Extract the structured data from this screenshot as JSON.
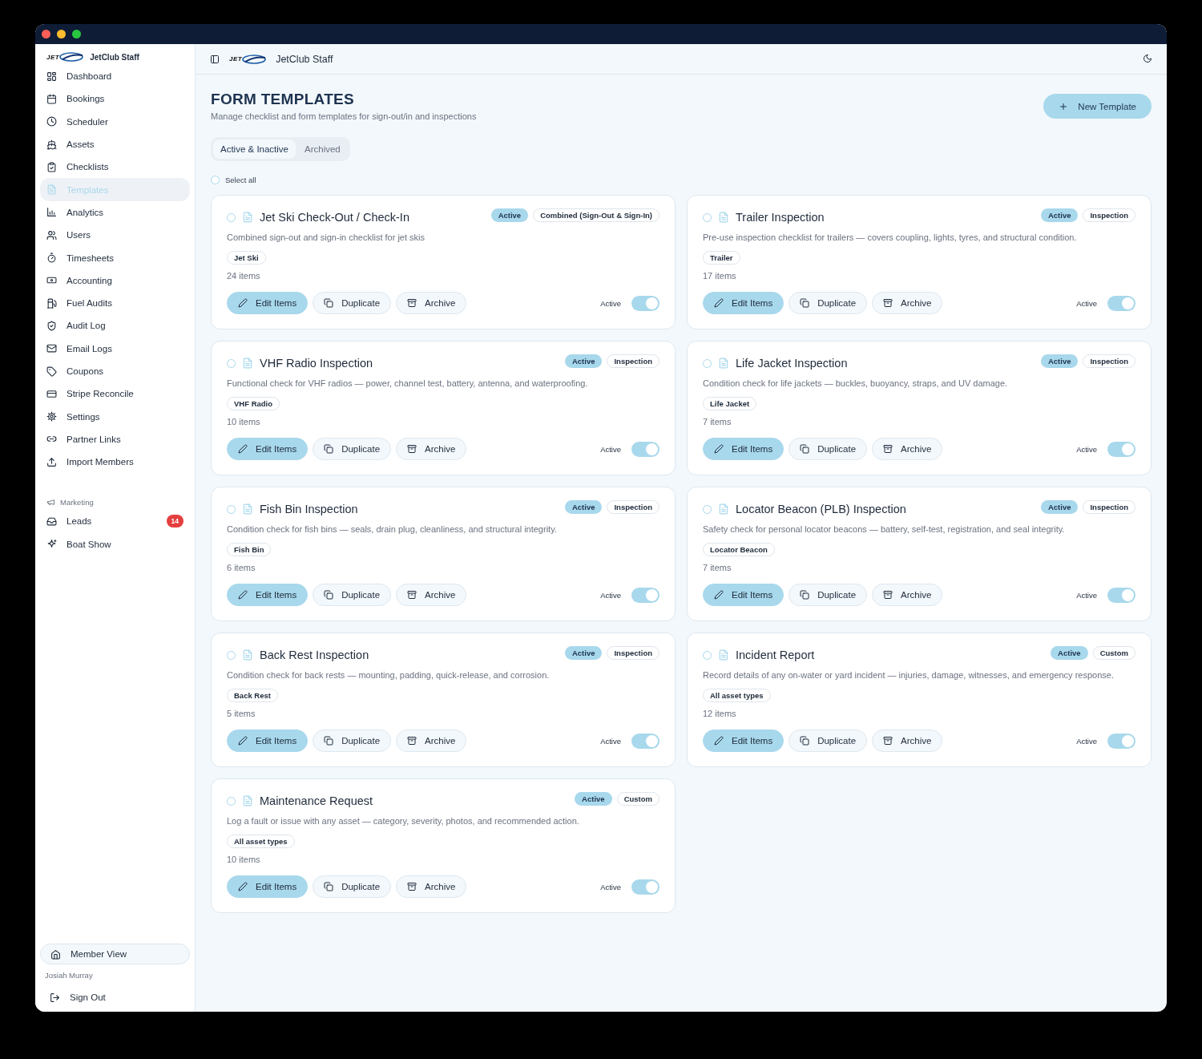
{
  "sidebar": {
    "brand": {
      "logo_text": "JET",
      "name": "JetClub Staff"
    },
    "items": [
      {
        "label": "Dashboard",
        "selected": false
      },
      {
        "label": "Bookings",
        "selected": false
      },
      {
        "label": "Scheduler",
        "selected": false
      },
      {
        "label": "Assets",
        "selected": false
      },
      {
        "label": "Checklists",
        "selected": false
      },
      {
        "label": "Templates",
        "selected": true
      },
      {
        "label": "Analytics",
        "selected": false
      },
      {
        "label": "Users",
        "selected": false
      },
      {
        "label": "Timesheets",
        "selected": false
      },
      {
        "label": "Accounting",
        "selected": false
      },
      {
        "label": "Fuel Audits",
        "selected": false
      },
      {
        "label": "Audit Log",
        "selected": false
      },
      {
        "label": "Email Logs",
        "selected": false
      },
      {
        "label": "Coupons",
        "selected": false
      },
      {
        "label": "Stripe Reconcile",
        "selected": false
      },
      {
        "label": "Settings",
        "selected": false
      },
      {
        "label": "Partner Links",
        "selected": false
      },
      {
        "label": "Import Members",
        "selected": false
      }
    ],
    "section": {
      "title": "Marketing",
      "items": [
        {
          "label": "Leads",
          "badge": "14",
          "selected": false
        },
        {
          "label": "Boat Show",
          "selected": false
        }
      ]
    },
    "member_view": "Member View",
    "user": "Josiah Murray",
    "sign_out": "Sign Out"
  },
  "topbar": {
    "logo_text": "JET",
    "title": "JetClub Staff"
  },
  "page": {
    "title": "FORM TEMPLATES",
    "subtitle": "Manage checklist and form templates for sign-out/in and inspections",
    "new_button": "New Template"
  },
  "tabs": [
    {
      "label": "Active & Inactive",
      "selected": true
    },
    {
      "label": "Archived",
      "selected": false
    }
  ],
  "select_all": {
    "label": "Select all",
    "checked": false
  },
  "templates": [
    {
      "title": "Jet Ski Check-Out / Check-In",
      "status": "Active",
      "type": "Combined (Sign-Out & Sign-In)",
      "description": "Combined sign-out and sign-in checklist for jet skis",
      "asset": "Jet Ski",
      "count": "24 items",
      "checked": false,
      "actions": [
        "Edit Items",
        "Duplicate",
        "Archive"
      ],
      "toggle_label": "Active",
      "active": true
    },
    {
      "title": "Trailer Inspection",
      "status": "Active",
      "type": "Inspection",
      "description": "Pre-use inspection checklist for trailers — covers coupling, lights, tyres, and structural condition.",
      "asset": "Trailer",
      "count": "17 items",
      "checked": false,
      "actions": [
        "Edit Items",
        "Duplicate",
        "Archive"
      ],
      "toggle_label": "Active",
      "active": true
    },
    {
      "title": "VHF Radio Inspection",
      "status": "Active",
      "type": "Inspection",
      "description": "Functional check for VHF radios — power, channel test, battery, antenna, and waterproofing.",
      "asset": "VHF Radio",
      "count": "10 items",
      "checked": false,
      "actions": [
        "Edit Items",
        "Duplicate",
        "Archive"
      ],
      "toggle_label": "Active",
      "active": true
    },
    {
      "title": "Life Jacket Inspection",
      "status": "Active",
      "type": "Inspection",
      "description": "Condition check for life jackets — buckles, buoyancy, straps, and UV damage.",
      "asset": "Life Jacket",
      "count": "7 items",
      "checked": false,
      "actions": [
        "Edit Items",
        "Duplicate",
        "Archive"
      ],
      "toggle_label": "Active",
      "active": true
    },
    {
      "title": "Fish Bin Inspection",
      "status": "Active",
      "type": "Inspection",
      "description": "Condition check for fish bins — seals, drain plug, cleanliness, and structural integrity.",
      "asset": "Fish Bin",
      "count": "6 items",
      "checked": false,
      "actions": [
        "Edit Items",
        "Duplicate",
        "Archive"
      ],
      "toggle_label": "Active",
      "active": true
    },
    {
      "title": "Locator Beacon (PLB) Inspection",
      "status": "Active",
      "type": "Inspection",
      "description": "Safety check for personal locator beacons — battery, self-test, registration, and seal integrity.",
      "asset": "Locator Beacon",
      "count": "7 items",
      "checked": false,
      "actions": [
        "Edit Items",
        "Duplicate",
        "Archive"
      ],
      "toggle_label": "Active",
      "active": true
    },
    {
      "title": "Back Rest Inspection",
      "status": "Active",
      "type": "Inspection",
      "description": "Condition check for back rests — mounting, padding, quick-release, and corrosion.",
      "asset": "Back Rest",
      "count": "5 items",
      "checked": false,
      "actions": [
        "Edit Items",
        "Duplicate",
        "Archive"
      ],
      "toggle_label": "Active",
      "active": true
    },
    {
      "title": "Incident Report",
      "status": "Active",
      "type": "Custom",
      "description": "Record details of any on-water or yard incident — injuries, damage, witnesses, and emergency response.",
      "asset": "All asset types",
      "count": "12 items",
      "checked": false,
      "actions": [
        "Edit Items",
        "Duplicate",
        "Archive"
      ],
      "toggle_label": "Active",
      "active": true
    },
    {
      "title": "Maintenance Request",
      "status": "Active",
      "type": "Custom",
      "description": "Log a fault or issue with any asset — category, severity, photos, and recommended action.",
      "asset": "All asset types",
      "count": "10 items",
      "checked": false,
      "actions": [
        "Edit Items",
        "Duplicate",
        "Archive"
      ],
      "toggle_label": "Active",
      "active": true
    }
  ]
}
